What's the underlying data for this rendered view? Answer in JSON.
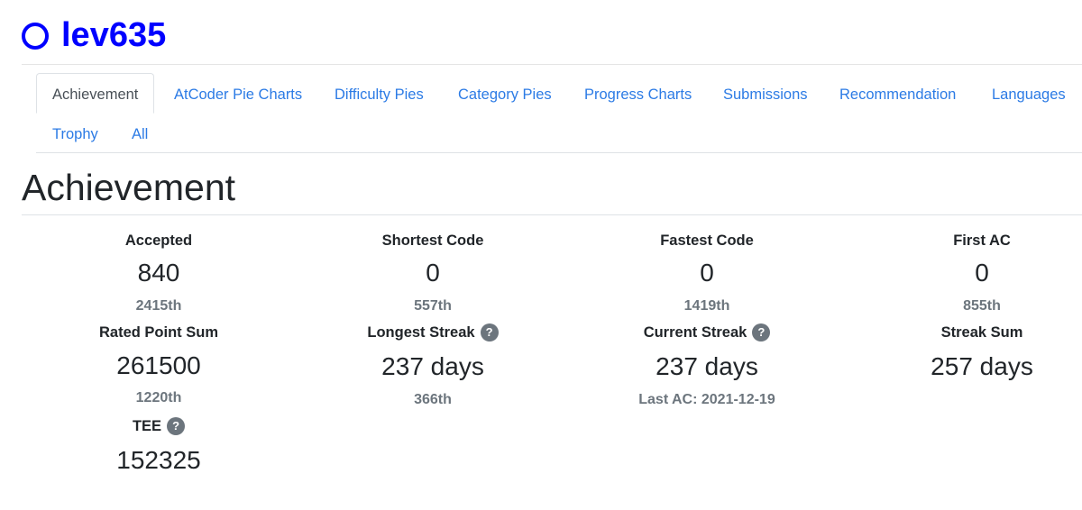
{
  "user": {
    "name": "lev635",
    "color": "#0000ff"
  },
  "tabs": [
    {
      "label": "Achievement",
      "active": true
    },
    {
      "label": "AtCoder Pie Charts"
    },
    {
      "label": "Difficulty Pies"
    },
    {
      "label": "Category Pies"
    },
    {
      "label": "Progress Charts"
    },
    {
      "label": "Submissions"
    },
    {
      "label": "Recommendation"
    },
    {
      "label": "Languages"
    },
    {
      "label": "Trophy"
    },
    {
      "label": "All"
    }
  ],
  "section_title": "Achievement",
  "help_glyph": "?",
  "stats": {
    "accepted": {
      "label": "Accepted",
      "value": "840",
      "rank": "2415th"
    },
    "shortest_code": {
      "label": "Shortest Code",
      "value": "0",
      "rank": "557th"
    },
    "fastest_code": {
      "label": "Fastest Code",
      "value": "0",
      "rank": "1419th"
    },
    "first_ac": {
      "label": "First AC",
      "value": "0",
      "rank": "855th"
    },
    "rated_point_sum": {
      "label": "Rated Point Sum",
      "value": "261500",
      "rank": "1220th"
    },
    "longest_streak": {
      "label": "Longest Streak",
      "value": "237 days",
      "rank": "366th"
    },
    "current_streak": {
      "label": "Current Streak",
      "value": "237 days",
      "sub": "Last AC: 2021-12-19"
    },
    "streak_sum": {
      "label": "Streak Sum",
      "value": "257 days"
    },
    "tee": {
      "label": "TEE",
      "value": "152325"
    }
  }
}
